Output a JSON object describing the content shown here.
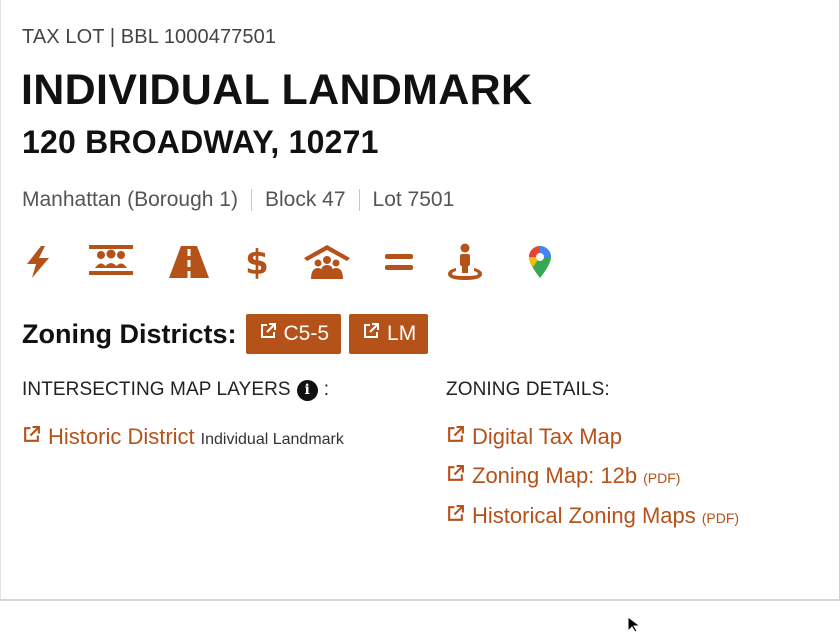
{
  "header": {
    "eyebrow": "TAX LOT | BBL 1000477501",
    "title": "INDIVIDUAL LANDMARK",
    "address": "120 BROADWAY, 10271"
  },
  "meta": {
    "borough": "Manhattan (Borough 1)",
    "block": "Block 47",
    "lot": "Lot 7501"
  },
  "icons": [
    "lightning-icon",
    "community-board-icon",
    "road-icon",
    "dollar-icon",
    "housing-icon",
    "equals-icon",
    "person-location-icon",
    "google-maps-icon"
  ],
  "zoning": {
    "label": "Zoning Districts:",
    "districts": [
      "C5-5",
      "LM"
    ]
  },
  "intersecting": {
    "heading": "INTERSECTING MAP LAYERS",
    "heading_suffix": ":",
    "link_label": "Historic District",
    "link_detail": "Individual Landmark"
  },
  "details": {
    "heading": "ZONING DETAILS:",
    "links": [
      {
        "label": "Digital Tax Map",
        "suffix": ""
      },
      {
        "label": "Zoning Map: 12b",
        "suffix": "(PDF)"
      },
      {
        "label": "Historical Zoning Maps",
        "suffix": "(PDF)"
      }
    ]
  },
  "colors": {
    "accent": "#b5521a",
    "text": "#111111"
  }
}
